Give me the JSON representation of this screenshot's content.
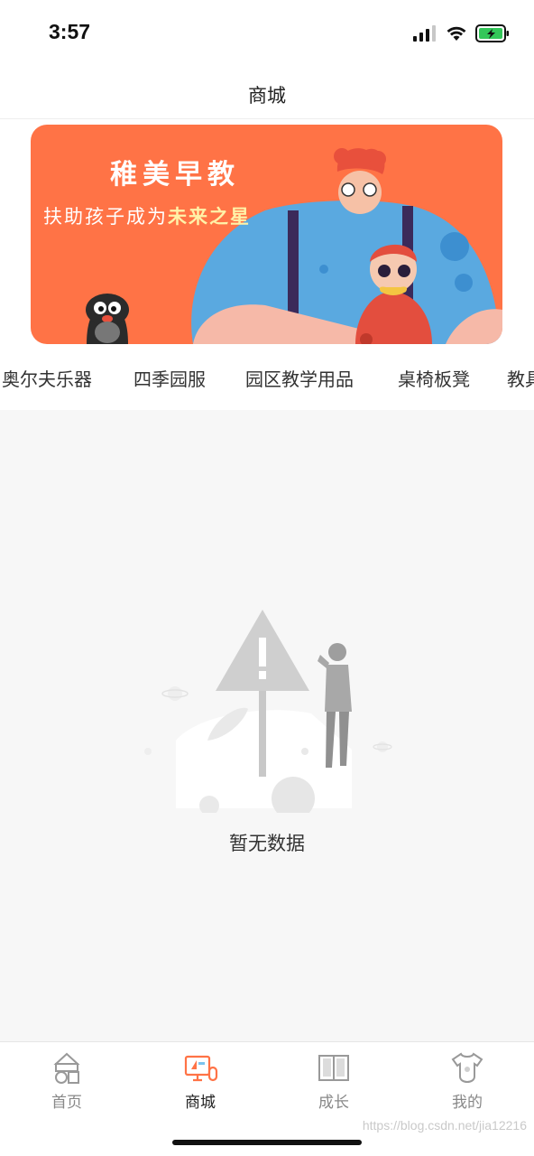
{
  "status_bar": {
    "time": "3:57"
  },
  "nav": {
    "title": "商城"
  },
  "banner": {
    "title": "稚美早教",
    "subtitle_prefix": "扶助孩子成为",
    "subtitle_highlight": "未来之星",
    "background_color": "#ff7346"
  },
  "categories": [
    "奥尔夫乐器",
    "四季园服",
    "园区教学用品",
    "桌椅板凳",
    "教具"
  ],
  "empty_state": {
    "message": "暂无数据"
  },
  "tab_bar": {
    "items": [
      {
        "label": "首页",
        "icon": "home-blocks-icon",
        "active": false
      },
      {
        "label": "商城",
        "icon": "shop-monitor-icon",
        "active": true
      },
      {
        "label": "成长",
        "icon": "book-icon",
        "active": false
      },
      {
        "label": "我的",
        "icon": "baby-clothes-icon",
        "active": false
      }
    ],
    "active_color": "#ff7346"
  },
  "watermark": "https://blog.csdn.net/jia12216"
}
